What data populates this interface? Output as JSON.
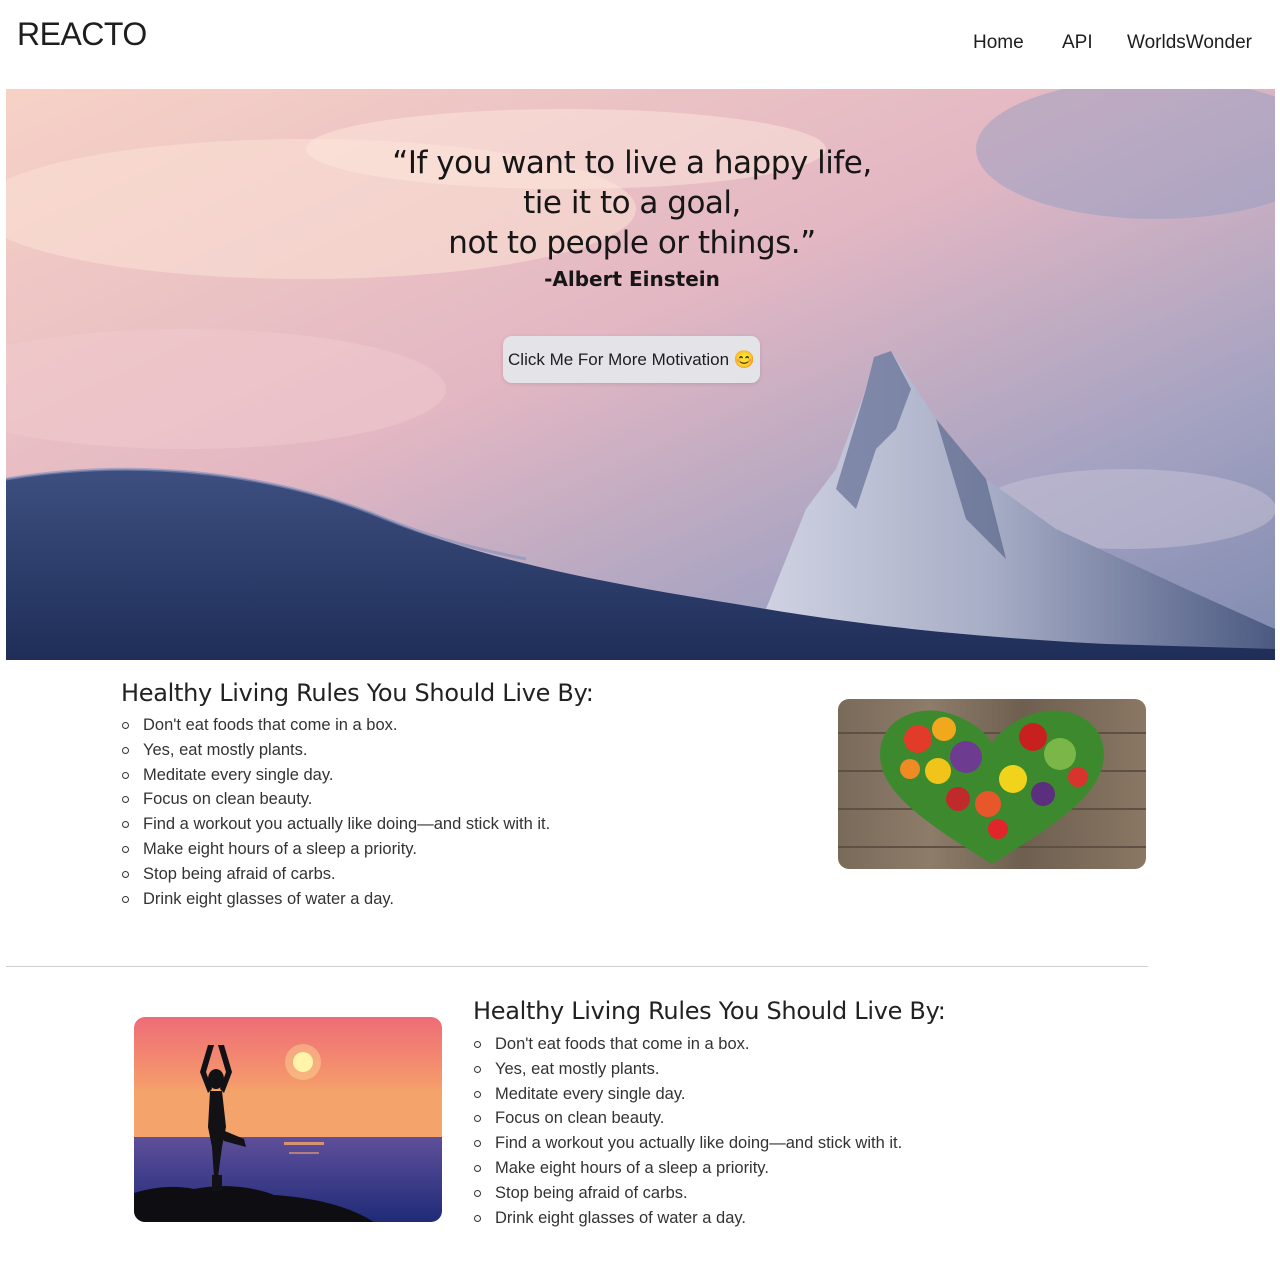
{
  "navbar": {
    "brand": "REACTO",
    "links": [
      "Home",
      "API",
      "WorldsWonder"
    ]
  },
  "hero": {
    "quote_lines": [
      "“If you want to live a happy life,",
      "tie it to a goal,",
      "not to people or things.”"
    ],
    "author": "-Albert Einstein",
    "button_label": "Click Me For More Motivation 😊"
  },
  "section1": {
    "title": "Healthy Living Rules You Should Live By:",
    "rules": [
      "Don't eat foods that come in a box.",
      "Yes, eat mostly plants.",
      "Meditate every single day.",
      "Focus on clean beauty.",
      "Find a workout you actually like doing—and stick with it.",
      "Make eight hours of a sleep a priority.",
      "Stop being afraid of carbs.",
      "Drink eight glasses of water a day."
    ]
  },
  "section2": {
    "title": "Healthy Living Rules You Should Live By:",
    "rules": [
      "Don't eat foods that come in a box.",
      "Yes, eat mostly plants.",
      "Meditate every single day.",
      "Focus on clean beauty.",
      "Find a workout you actually like doing—and stick with it.",
      "Make eight hours of a sleep a priority.",
      "Stop being afraid of carbs.",
      "Drink eight glasses of water a day."
    ]
  }
}
